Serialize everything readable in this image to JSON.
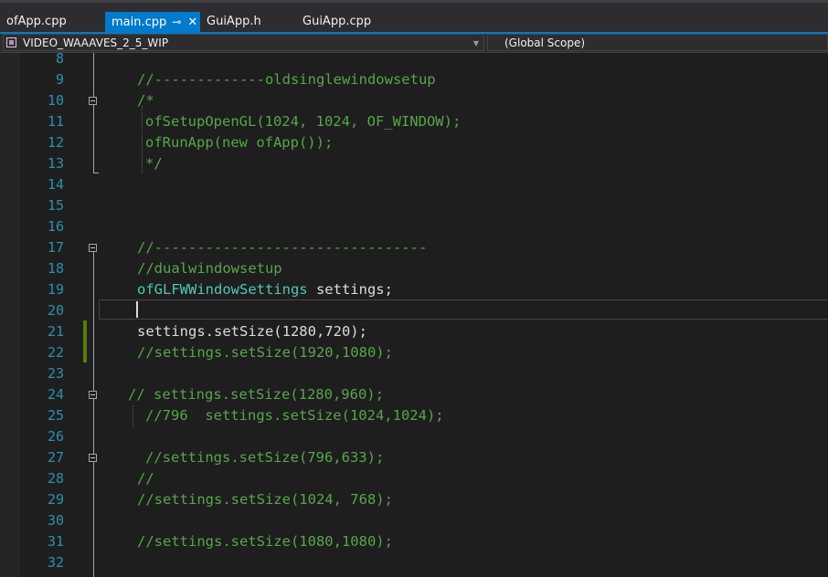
{
  "tabs": [
    {
      "label": "ofApp.cpp",
      "active": false
    },
    {
      "label": "main.cpp",
      "active": true,
      "pin_icon": "pin-icon",
      "close_icon": "close-icon"
    },
    {
      "label": "GuiApp.h",
      "active": false
    },
    {
      "label": "GuiApp.cpp",
      "active": false
    }
  ],
  "navbar": {
    "project": "VIDEO_WAAAVES_2_5_WIP",
    "scope": "(Global Scope)",
    "project_icon": "project-icon",
    "dropdown_icon": "chevron-down-icon"
  },
  "colors": {
    "accent": "#007acc",
    "line_number": "#2b91af",
    "comment": "#57a64a",
    "type": "#4ec9b0",
    "plain": "#dcdcdc",
    "change_bar": "#587c0c"
  },
  "editor": {
    "lines": [
      {
        "num": "8",
        "kind": "plain",
        "text": ""
      },
      {
        "num": "9",
        "kind": "comment",
        "text": "//-------------oldsinglewindowsetup"
      },
      {
        "num": "10",
        "kind": "comment",
        "text": "/*"
      },
      {
        "num": "11",
        "kind": "comment",
        "text": "ofSetupOpenGL(1024, 1024, OF_WINDOW);"
      },
      {
        "num": "12",
        "kind": "comment",
        "text": "ofRunApp(new ofApp());"
      },
      {
        "num": "13",
        "kind": "comment",
        "text": "*/"
      },
      {
        "num": "14",
        "kind": "plain",
        "text": ""
      },
      {
        "num": "15",
        "kind": "plain",
        "text": ""
      },
      {
        "num": "16",
        "kind": "plain",
        "text": ""
      },
      {
        "num": "17",
        "kind": "comment",
        "text": "//--------------------------------"
      },
      {
        "num": "18",
        "kind": "comment",
        "text": "//dualwindowsetup"
      },
      {
        "num": "19",
        "kind": "decl",
        "type": "ofGLFWWindowSettings",
        "text": " settings;"
      },
      {
        "num": "20",
        "kind": "plain",
        "text": ""
      },
      {
        "num": "21",
        "kind": "plain",
        "text": "settings.setSize(1280,720);"
      },
      {
        "num": "22",
        "kind": "comment",
        "text": "//settings.setSize(1920,1080);"
      },
      {
        "num": "23",
        "kind": "plain",
        "text": ""
      },
      {
        "num": "24",
        "kind": "comment",
        "text": "// settings.setSize(1280,960);"
      },
      {
        "num": "25",
        "kind": "comment",
        "text": "//796  settings.setSize(1024,1024);"
      },
      {
        "num": "26",
        "kind": "plain",
        "text": ""
      },
      {
        "num": "27",
        "kind": "comment",
        "text": "//settings.setSize(796,633);"
      },
      {
        "num": "28",
        "kind": "comment",
        "text": "//"
      },
      {
        "num": "29",
        "kind": "comment",
        "text": "//settings.setSize(1024, 768);"
      },
      {
        "num": "30",
        "kind": "plain",
        "text": ""
      },
      {
        "num": "31",
        "kind": "comment",
        "text": "//settings.setSize(1080,1080);"
      },
      {
        "num": "32",
        "kind": "plain",
        "text": ""
      }
    ]
  }
}
